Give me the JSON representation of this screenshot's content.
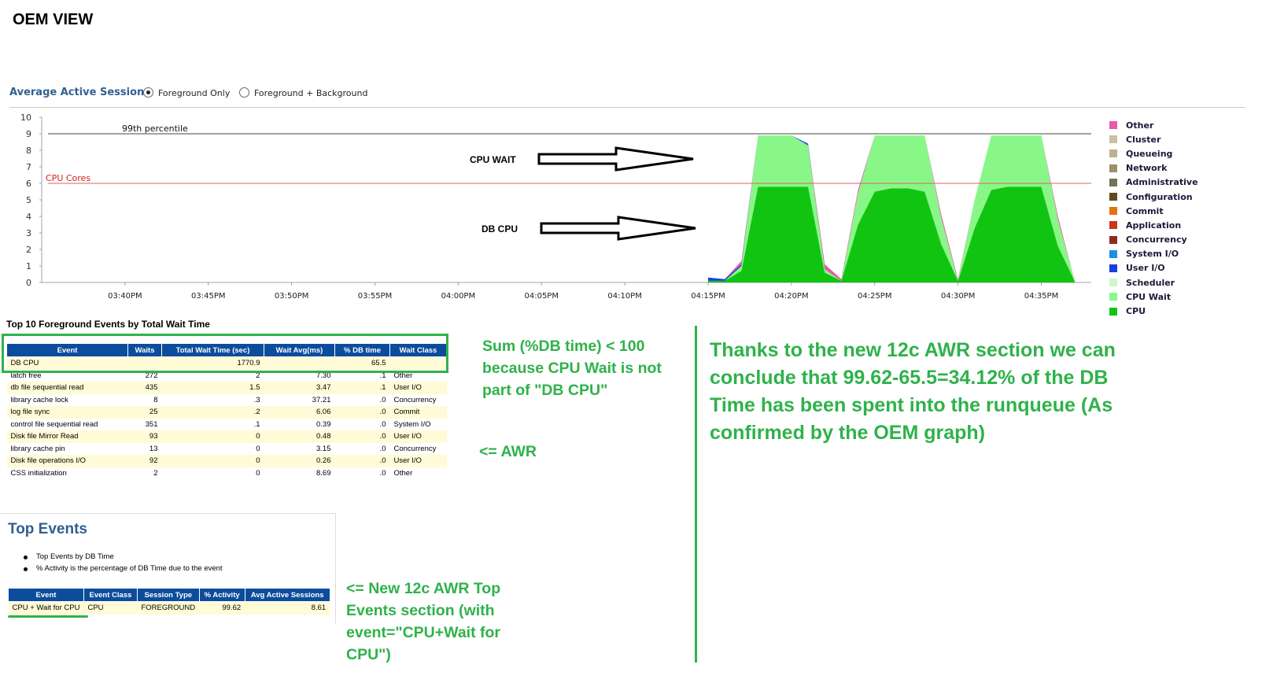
{
  "page_title": "OEM VIEW",
  "aas": {
    "title": "Average Active Sessions",
    "radio_foreground": "Foreground Only",
    "radio_fg_bg": "Foreground + Background",
    "selected": "Foreground Only"
  },
  "chart_data": {
    "type": "area",
    "ylim": [
      0,
      10
    ],
    "yticks": [
      "0",
      "1",
      "2",
      "3",
      "4",
      "5",
      "6",
      "7",
      "8",
      "9",
      "10"
    ],
    "xticks": [
      "03:40PM",
      "03:45PM",
      "03:50PM",
      "03:55PM",
      "04:00PM",
      "04:05PM",
      "04:10PM",
      "04:15PM",
      "04:20PM",
      "04:25PM",
      "04:30PM",
      "04:35PM"
    ],
    "reference_lines": [
      {
        "label": "99th percentile",
        "value": 9,
        "color": "#444444"
      },
      {
        "label": "CPU Cores",
        "value": 6,
        "color": "#e06060"
      }
    ],
    "legend": [
      "Other",
      "Cluster",
      "Queueing",
      "Network",
      "Administrative",
      "Configuration",
      "Commit",
      "Application",
      "Concurrency",
      "System I/O",
      "User I/O",
      "Scheduler",
      "CPU Wait",
      "CPU"
    ],
    "legend_colors": [
      "#e65aa8",
      "#c8bfa5",
      "#bfb08f",
      "#9c8f6e",
      "#73725a",
      "#5d4a22",
      "#e2720b",
      "#c8361c",
      "#8c2b1e",
      "#1a91e0",
      "#1a3fe0",
      "#ccf7cc",
      "#88f788",
      "#12c412"
    ],
    "x_domain": [
      "03:35PM",
      "04:38PM"
    ],
    "series": [
      {
        "name": "CPU",
        "x": [
          "04:15PM",
          "04:16PM",
          "04:17PM",
          "04:18PM",
          "04:19PM",
          "04:20PM",
          "04:21PM",
          "04:22PM",
          "04:23PM",
          "04:24PM",
          "04:25PM",
          "04:26PM",
          "04:27PM",
          "04:28PM",
          "04:29PM",
          "04:30PM",
          "04:31PM",
          "04:32PM",
          "04:33PM",
          "04:34PM",
          "04:35PM",
          "04:36PM",
          "04:37PM"
        ],
        "values": [
          0.1,
          0.1,
          0.7,
          5.8,
          5.8,
          5.8,
          5.8,
          0.6,
          0.1,
          3.5,
          5.5,
          5.7,
          5.7,
          5.5,
          2.3,
          0.1,
          3.3,
          5.6,
          5.8,
          5.8,
          5.8,
          2.2,
          0.1
        ]
      },
      {
        "name": "CPU Wait",
        "x": [
          "04:15PM",
          "04:16PM",
          "04:17PM",
          "04:18PM",
          "04:19PM",
          "04:20PM",
          "04:21PM",
          "04:22PM",
          "04:23PM",
          "04:24PM",
          "04:25PM",
          "04:26PM",
          "04:27PM",
          "04:28PM",
          "04:29PM",
          "04:30PM",
          "04:31PM",
          "04:32PM",
          "04:33PM",
          "04:34PM",
          "04:35PM",
          "04:36PM",
          "04:37PM"
        ],
        "values": [
          0.0,
          0.0,
          0.3,
          3.1,
          3.1,
          3.1,
          2.5,
          0.2,
          0.0,
          1.9,
          3.4,
          3.2,
          3.2,
          3.4,
          1.6,
          0.0,
          1.7,
          3.3,
          3.1,
          3.1,
          3.1,
          1.6,
          0.0
        ]
      },
      {
        "name": "User I/O",
        "x": [
          "04:15PM",
          "04:16PM",
          "04:17PM",
          "04:18PM",
          "04:19PM",
          "04:20PM",
          "04:21PM",
          "04:22PM",
          "04:23PM",
          "04:24PM",
          "04:25PM",
          "04:26PM",
          "04:27PM",
          "04:28PM",
          "04:29PM",
          "04:30PM",
          "04:31PM",
          "04:32PM",
          "04:33PM",
          "04:34PM",
          "04:35PM",
          "04:36PM",
          "04:37PM"
        ],
        "values": [
          0.2,
          0.1,
          0.1,
          0.0,
          0.0,
          0.0,
          0.1,
          0.0,
          0.0,
          0.0,
          0.0,
          0.0,
          0.0,
          0.0,
          0.0,
          0.0,
          0.0,
          0.0,
          0.0,
          0.0,
          0.0,
          0.0,
          0.0
        ]
      },
      {
        "name": "Other",
        "x": [
          "04:15PM",
          "04:16PM",
          "04:17PM",
          "04:18PM",
          "04:19PM",
          "04:20PM",
          "04:21PM",
          "04:22PM",
          "04:23PM",
          "04:24PM",
          "04:25PM",
          "04:26PM",
          "04:27PM",
          "04:28PM",
          "04:29PM",
          "04:30PM",
          "04:31PM",
          "04:32PM",
          "04:33PM",
          "04:34PM",
          "04:35PM",
          "04:36PM",
          "04:37PM"
        ],
        "values": [
          0.0,
          0.0,
          0.2,
          0.0,
          0.0,
          0.0,
          0.0,
          0.3,
          0.1,
          0.2,
          0.0,
          0.0,
          0.0,
          0.0,
          0.2,
          0.1,
          0.0,
          0.0,
          0.0,
          0.0,
          0.0,
          0.2,
          0.0
        ]
      }
    ]
  },
  "annotations": {
    "cpu_wait_label": "CPU WAIT",
    "db_cpu_label": "DB CPU",
    "sum_note": "Sum (%DB time) < 100 because CPU Wait is not part of \"DB CPU\"",
    "awr_note": "<= AWR",
    "new_awr_note": "<= New 12c AWR Top Events section (with event=\"CPU+Wait for CPU\")",
    "conclusion": "Thanks to the new 12c AWR section we can conclude that 99.62-65.5=34.12% of the DB Time has been spent into the runqueue (As confirmed by the OEM graph)"
  },
  "fg_events": {
    "title": "Top 10 Foreground Events by Total Wait Time",
    "headers": [
      "Event",
      "Waits",
      "Total Wait Time (sec)",
      "Wait Avg(ms)",
      "% DB time",
      "Wait Class"
    ],
    "rows": [
      [
        "DB CPU",
        "",
        "1770.9",
        "",
        "65.5",
        ""
      ],
      [
        "latch free",
        "272",
        "2",
        "7.30",
        ".1",
        "Other"
      ],
      [
        "db file sequential read",
        "435",
        "1.5",
        "3.47",
        ".1",
        "User I/O"
      ],
      [
        "library cache lock",
        "8",
        ".3",
        "37.21",
        ".0",
        "Concurrency"
      ],
      [
        "log file sync",
        "25",
        ".2",
        "6.06",
        ".0",
        "Commit"
      ],
      [
        "control file sequential read",
        "351",
        ".1",
        "0.39",
        ".0",
        "System I/O"
      ],
      [
        "Disk file Mirror Read",
        "93",
        "0",
        "0.48",
        ".0",
        "User I/O"
      ],
      [
        "library cache pin",
        "13",
        "0",
        "3.15",
        ".0",
        "Concurrency"
      ],
      [
        "Disk file operations I/O",
        "92",
        "0",
        "0.26",
        ".0",
        "User I/O"
      ],
      [
        "CSS initialization",
        "2",
        "0",
        "8.69",
        ".0",
        "Other"
      ]
    ]
  },
  "top_events": {
    "title": "Top Events",
    "bullets": [
      "Top Events by DB Time",
      "% Activity is the percentage of DB Time due to the event"
    ],
    "headers": [
      "Event",
      "Event Class",
      "Session Type",
      "% Activity",
      "Avg Active Sessions"
    ],
    "rows": [
      [
        "CPU + Wait for CPU",
        "CPU",
        "FOREGROUND",
        "99.62",
        "8.61"
      ]
    ]
  }
}
